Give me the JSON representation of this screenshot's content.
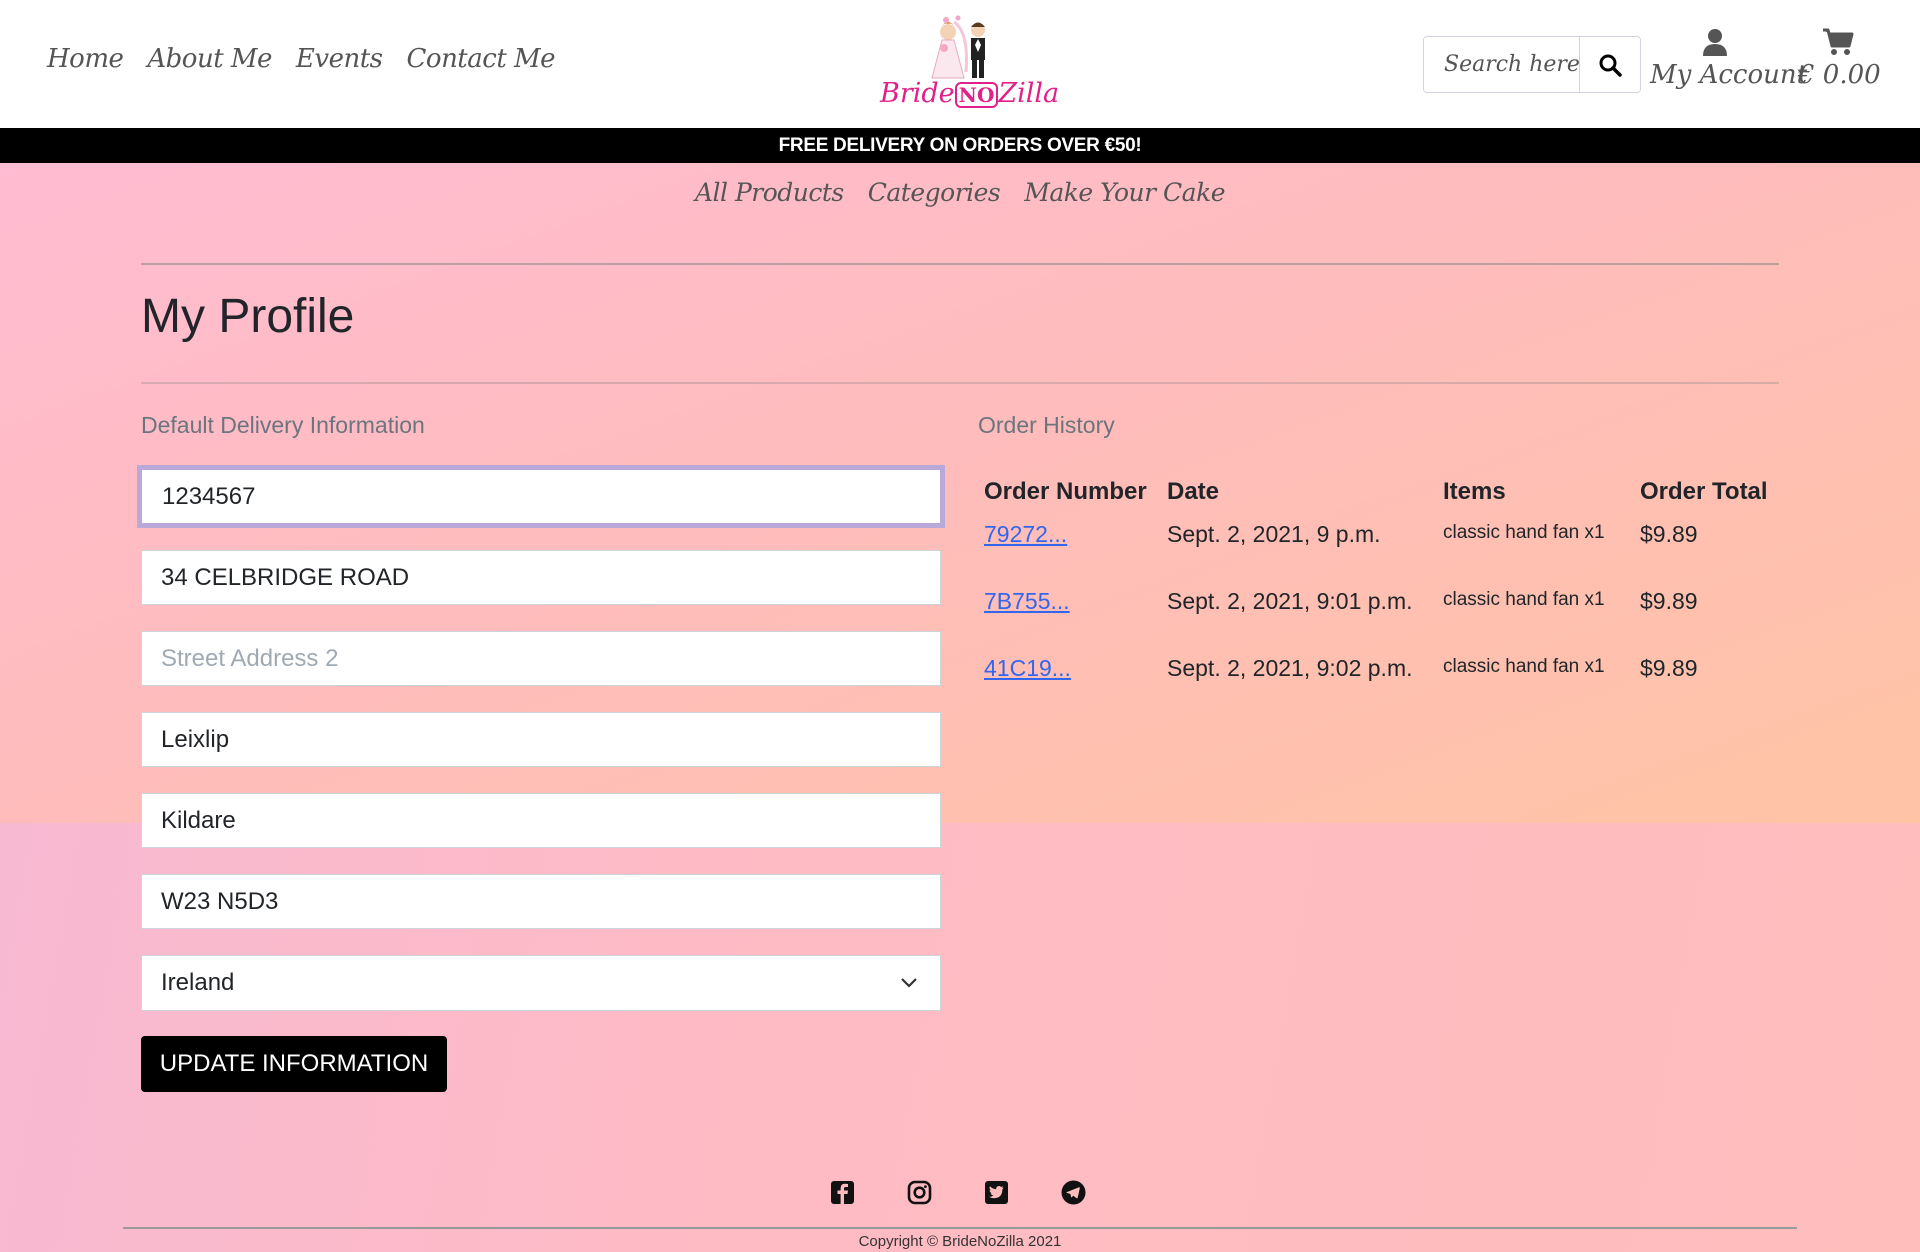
{
  "header": {
    "nav": [
      "Home",
      "About Me",
      "Events",
      "Contact Me"
    ],
    "logo_text_a": "Bride",
    "logo_text_b": "NO",
    "logo_text_c": "Zilla",
    "search_placeholder": "Search here",
    "account_label": "My Account",
    "cart_total": "€ 0.00"
  },
  "banner": "FREE DELIVERY ON ORDERS OVER €50!",
  "subnav": [
    "All Products",
    "Categories",
    "Make Your Cake"
  ],
  "page_title": "My Profile",
  "delivery": {
    "title": "Default Delivery Information",
    "phone": "1234567",
    "street1": "34 CELBRIDGE ROAD",
    "street2_placeholder": "Street Address 2",
    "town": "Leixlip",
    "county": "Kildare",
    "postcode": "W23 N5D3",
    "country": "Ireland",
    "button": "UPDATE INFORMATION"
  },
  "history": {
    "title": "Order History",
    "headers": [
      "Order Number",
      "Date",
      "Items",
      "Order Total"
    ],
    "rows": [
      {
        "number": "79272...",
        "date": "Sept. 2, 2021, 9 p.m.",
        "items": "classic hand fan x1",
        "total": "$9.89"
      },
      {
        "number": "7B755...",
        "date": "Sept. 2, 2021, 9:01 p.m.",
        "items": "classic hand fan x1",
        "total": "$9.89"
      },
      {
        "number": "41C19...",
        "date": "Sept. 2, 2021, 9:02 p.m.",
        "items": "classic hand fan x1",
        "total": "$9.89"
      }
    ]
  },
  "footer": {
    "icons": [
      "facebook-icon",
      "instagram-icon",
      "twitter-icon",
      "telegram-icon"
    ],
    "copyright": "Copyright © BrideNoZilla 2021"
  }
}
